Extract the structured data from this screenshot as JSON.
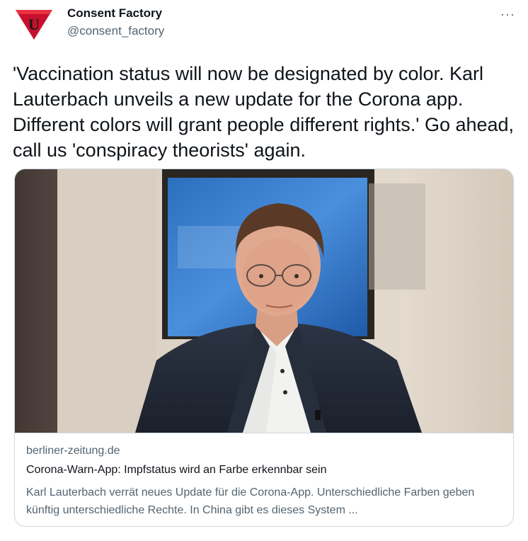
{
  "tweet": {
    "author": {
      "display_name": "Consent Factory",
      "handle": "@consent_factory",
      "avatar_icon": "red-triangle-logo-icon",
      "avatar_letter": "U",
      "avatar_color": "#c8102e"
    },
    "more_icon": "ellipsis-icon",
    "more_label": "···",
    "text": "'Vaccination status will now be designated by color. Karl Lauterbach unveils a new update for the Corona app. Different colors will grant people different rights.' Go ahead, call us 'conspiracy theorists' again."
  },
  "card": {
    "image_icon": "portrait-photo",
    "domain": "berliner-zeitung.de",
    "title": "Corona-Warn-App: Impfstatus wird an Farbe erkennbar sein",
    "description": "Karl Lauterbach verrät neues Update für die Corona-App. Unterschiedliche Farben geben künftig unterschiedliche Rechte. In China gibt es dieses System ..."
  },
  "colors": {
    "text_primary": "#0f1419",
    "text_secondary": "#536471",
    "border": "#cfd9de"
  }
}
